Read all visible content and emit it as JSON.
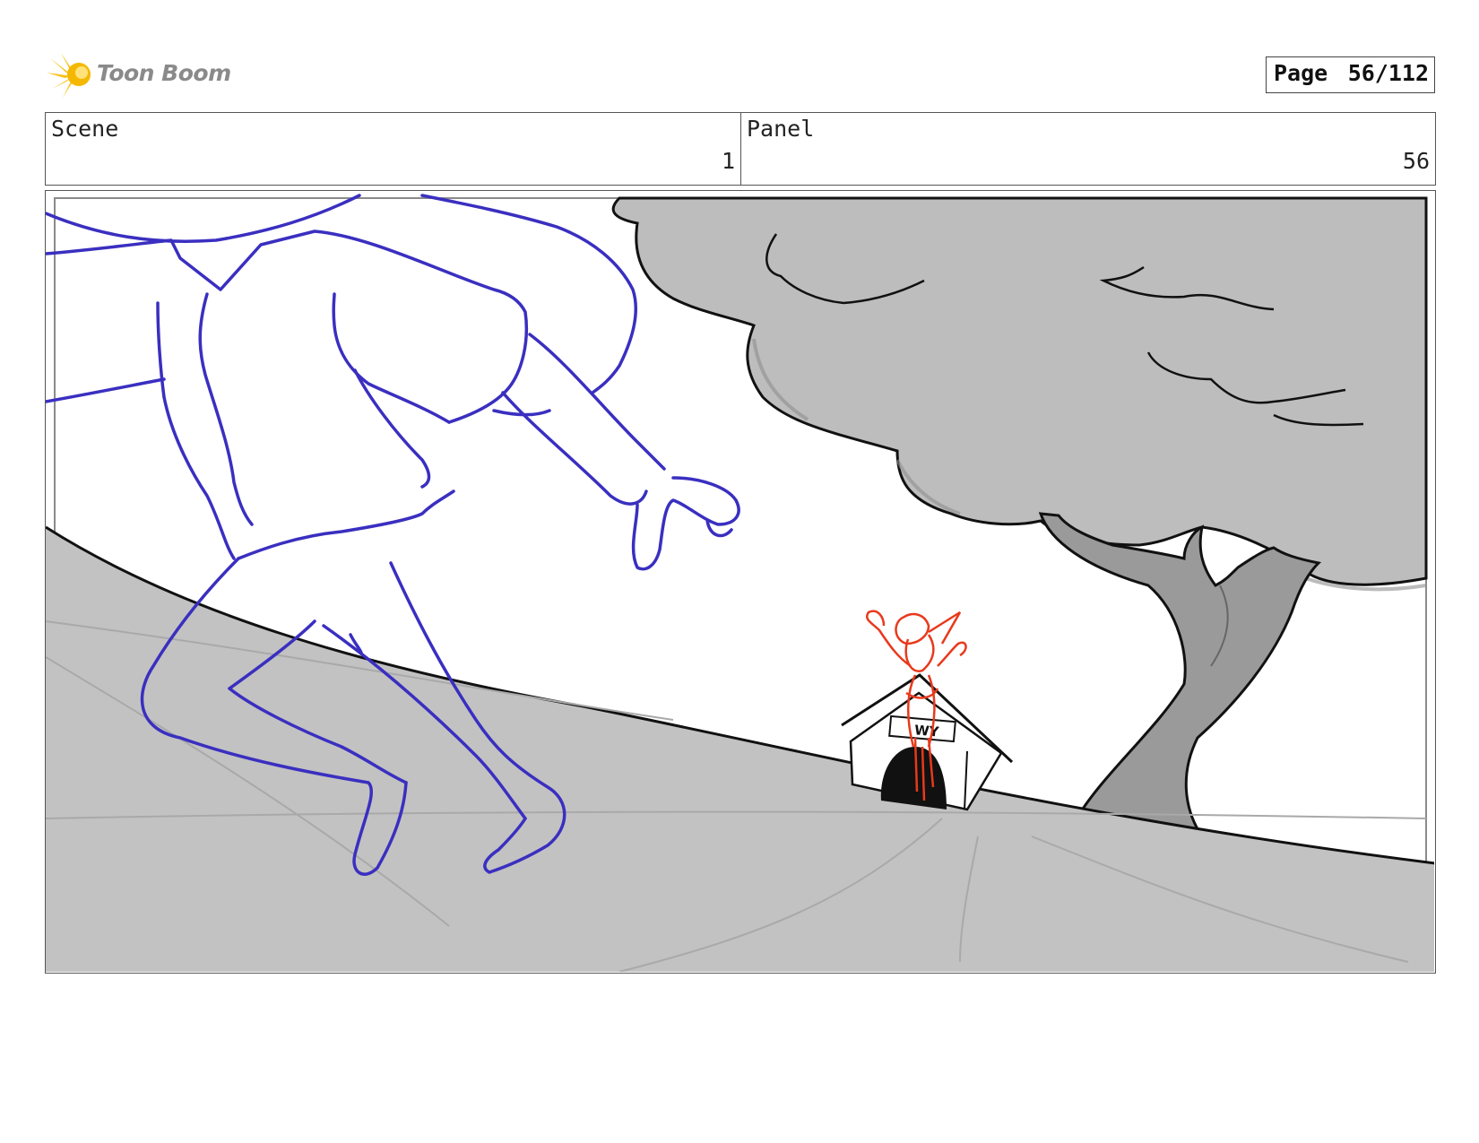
{
  "header": {
    "logo_text": "Toon Boom",
    "page_label": "Page",
    "page_number": "56/112"
  },
  "scene": {
    "label": "Scene",
    "value": "1"
  },
  "panel": {
    "label": "Panel",
    "value": "56"
  },
  "drawing": {
    "doghouse_sign": "WY",
    "colors": {
      "character_outline": "#3a2fc0",
      "dog_sketch": "#e8391c",
      "ground_fill": "#c2c2c2",
      "tree_foliage": "#bdbdbd",
      "tree_trunk": "#9a9a9a",
      "ink": "#111111"
    }
  }
}
